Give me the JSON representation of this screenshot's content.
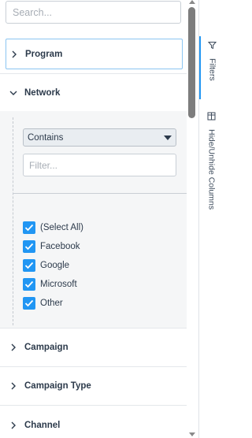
{
  "search": {
    "placeholder": "Search..."
  },
  "groups": {
    "program": {
      "label": "Program"
    },
    "network": {
      "label": "Network"
    },
    "campaign": {
      "label": "Campaign"
    },
    "campaign_type": {
      "label": "Campaign Type"
    },
    "channel": {
      "label": "Channel"
    }
  },
  "network_filter": {
    "operator": "Contains",
    "filter_placeholder": "Filter...",
    "options": [
      {
        "label": "(Select All)",
        "checked": true
      },
      {
        "label": "Facebook",
        "checked": true
      },
      {
        "label": "Google",
        "checked": true
      },
      {
        "label": "Microsoft",
        "checked": true
      },
      {
        "label": "Other",
        "checked": true
      }
    ]
  },
  "side_tabs": {
    "filters": {
      "label": "Filters",
      "icon": "funnel-icon"
    },
    "columns": {
      "label": "Hide/Unhide Columns",
      "icon": "columns-icon"
    }
  },
  "colors": {
    "accent": "#2196f3",
    "thumb": "#7d7d7d"
  }
}
